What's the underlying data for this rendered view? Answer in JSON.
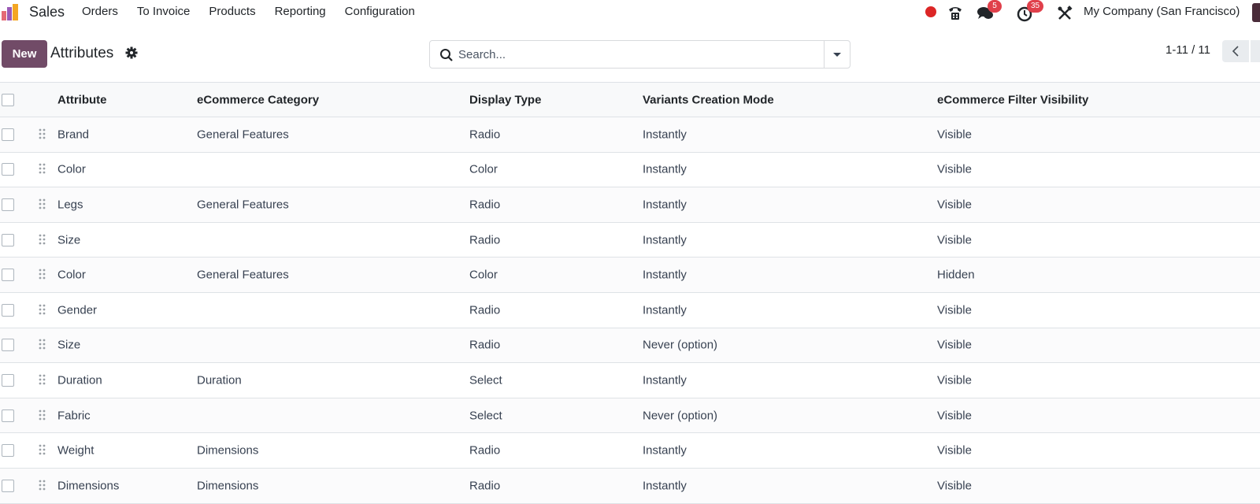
{
  "navbar": {
    "app_name": "Sales",
    "menu": [
      "Orders",
      "To Invoice",
      "Products",
      "Reporting",
      "Configuration"
    ],
    "messages_badge": "5",
    "activities_badge": "35",
    "company": "My Company (San Francisco)"
  },
  "control_panel": {
    "new_label": "New",
    "title": "Attributes",
    "search_placeholder": "Search...",
    "pager": "1-11 / 11"
  },
  "table": {
    "columns": [
      "Attribute",
      "eCommerce Category",
      "Display Type",
      "Variants Creation Mode",
      "eCommerce Filter Visibility"
    ],
    "rows": [
      [
        "Brand",
        "General Features",
        "Radio",
        "Instantly",
        "Visible"
      ],
      [
        "Color",
        "",
        "Color",
        "Instantly",
        "Visible"
      ],
      [
        "Legs",
        "General Features",
        "Radio",
        "Instantly",
        "Visible"
      ],
      [
        "Size",
        "",
        "Radio",
        "Instantly",
        "Visible"
      ],
      [
        "Color",
        "General Features",
        "Color",
        "Instantly",
        "Hidden"
      ],
      [
        "Gender",
        "",
        "Radio",
        "Instantly",
        "Visible"
      ],
      [
        "Size",
        "",
        "Radio",
        "Never (option)",
        "Visible"
      ],
      [
        "Duration",
        "Duration",
        "Select",
        "Instantly",
        "Visible"
      ],
      [
        "Fabric",
        "",
        "Select",
        "Never (option)",
        "Visible"
      ],
      [
        "Weight",
        "Dimensions",
        "Radio",
        "Instantly",
        "Visible"
      ],
      [
        "Dimensions",
        "Dimensions",
        "Radio",
        "Instantly",
        "Visible"
      ]
    ]
  },
  "colors": {
    "brand": "#714b67",
    "badge": "#e0404b",
    "record": "#dc2626"
  },
  "icons": [
    "app-logo-icon",
    "phone-icon",
    "chat-icon",
    "clock-icon",
    "tools-icon",
    "gear-icon",
    "search-icon",
    "chevron-left-icon",
    "drag-handle-icon"
  ]
}
